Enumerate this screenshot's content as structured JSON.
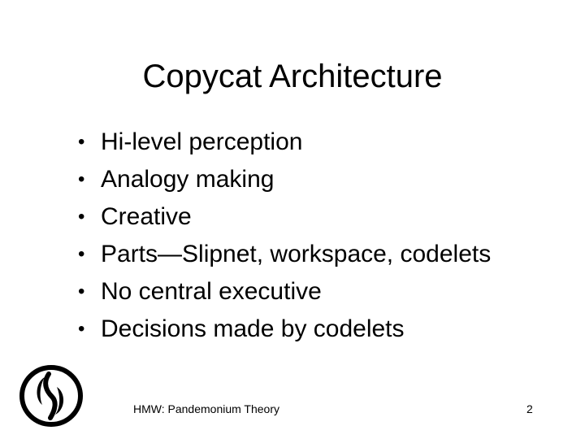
{
  "slide": {
    "title": "Copycat Architecture",
    "bullets": [
      "Hi-level perception",
      "Analogy making",
      "Creative",
      "Parts—Slipnet, workspace, codelets",
      "No central executive",
      "Decisions made by codelets"
    ],
    "bullet_glyph": "•",
    "footer": "HMW: Pandemonium Theory",
    "page_number": "2",
    "logo_icon": "ellipse-logo-icon",
    "colors": {
      "text": "#000000",
      "background": "#ffffff"
    }
  }
}
